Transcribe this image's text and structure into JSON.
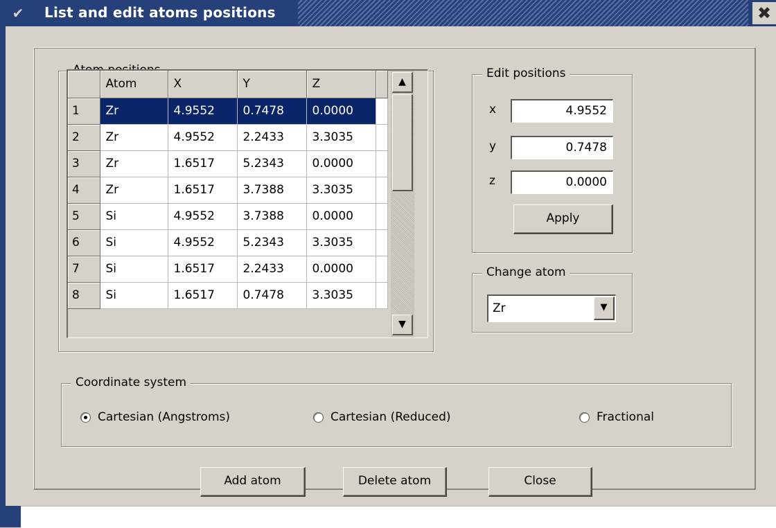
{
  "window": {
    "title": "List and edit atoms positions",
    "menu_icon": "chevron-down-icon",
    "close_icon": "close-icon"
  },
  "atom_positions": {
    "legend": "Atom positions",
    "columns": [
      "Atom",
      "X",
      "Y",
      "Z"
    ],
    "rows": [
      {
        "n": "1",
        "atom": "Zr",
        "x": "4.9552",
        "y": "0.7478",
        "z": "0.0000"
      },
      {
        "n": "2",
        "atom": "Zr",
        "x": "4.9552",
        "y": "2.2433",
        "z": "3.3035"
      },
      {
        "n": "3",
        "atom": "Zr",
        "x": "1.6517",
        "y": "5.2343",
        "z": "0.0000"
      },
      {
        "n": "4",
        "atom": "Zr",
        "x": "1.6517",
        "y": "3.7388",
        "z": "3.3035"
      },
      {
        "n": "5",
        "atom": "Si",
        "x": "4.9552",
        "y": "3.7388",
        "z": "0.0000"
      },
      {
        "n": "6",
        "atom": "Si",
        "x": "4.9552",
        "y": "5.2343",
        "z": "3.3035"
      },
      {
        "n": "7",
        "atom": "Si",
        "x": "1.6517",
        "y": "2.2433",
        "z": "0.0000"
      },
      {
        "n": "8",
        "atom": "Si",
        "x": "1.6517",
        "y": "0.7478",
        "z": "3.3035"
      }
    ],
    "selected_row": 1
  },
  "edit_positions": {
    "legend": "Edit positions",
    "x_label": "x",
    "x_value": "4.9552",
    "y_label": "y",
    "y_value": "0.7478",
    "z_label": "z",
    "z_value": "0.0000",
    "apply_label": "Apply"
  },
  "change_atom": {
    "legend": "Change atom",
    "selected": "Zr"
  },
  "coordinate_system": {
    "legend": "Coordinate system",
    "options": [
      {
        "label": "Cartesian (Angstroms)",
        "selected": true
      },
      {
        "label": "Cartesian (Reduced)",
        "selected": false
      },
      {
        "label": "Fractional",
        "selected": false
      }
    ]
  },
  "buttons": {
    "add_atom": "Add atom",
    "delete_atom": "Delete atom",
    "close": "Close"
  }
}
